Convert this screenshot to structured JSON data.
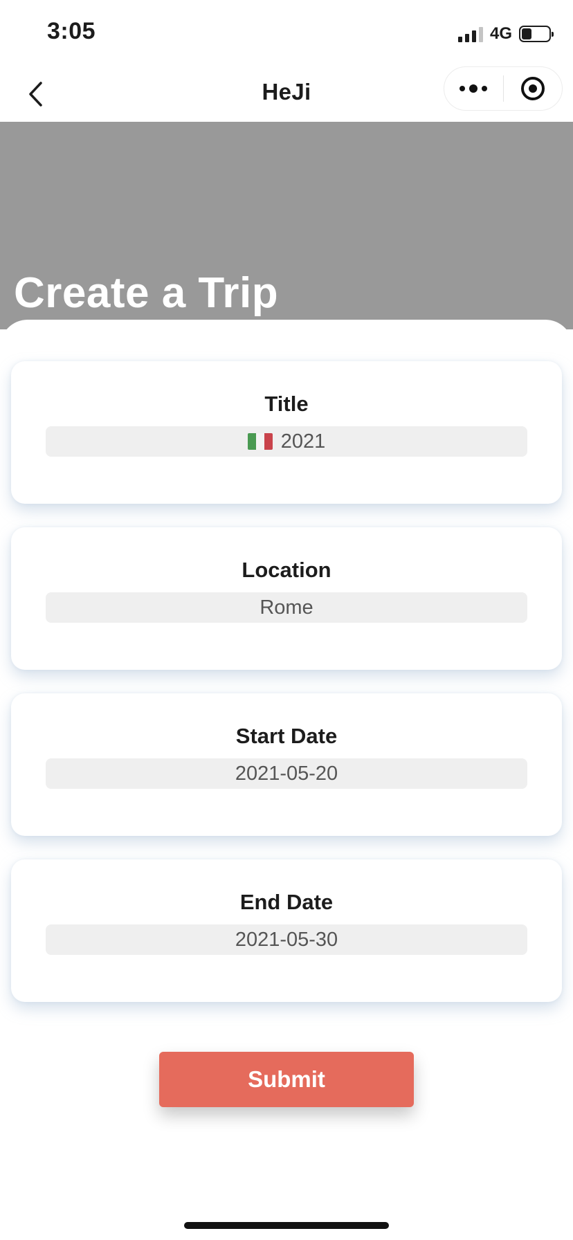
{
  "status_bar": {
    "time": "3:05",
    "network": "4G",
    "signal_bars": 3,
    "signal_max": 4,
    "battery_level": 0.36
  },
  "nav": {
    "title": "HeJi",
    "back_icon": "chevron-left-icon",
    "more_icon": "more-dots-icon",
    "close_icon": "target-circle-icon"
  },
  "hero": {
    "title": "Create a Trip",
    "background_color": "#999999"
  },
  "form": {
    "title_field": {
      "label": "Title",
      "value": "2021",
      "flag_icon": "italy-flag-icon"
    },
    "location_field": {
      "label": "Location",
      "value": "Rome"
    },
    "start_date_field": {
      "label": "Start Date",
      "value": "2021-05-20"
    },
    "end_date_field": {
      "label": "End Date",
      "value": "2021-05-30"
    }
  },
  "submit": {
    "label": "Submit",
    "color": "#e56b5c"
  }
}
